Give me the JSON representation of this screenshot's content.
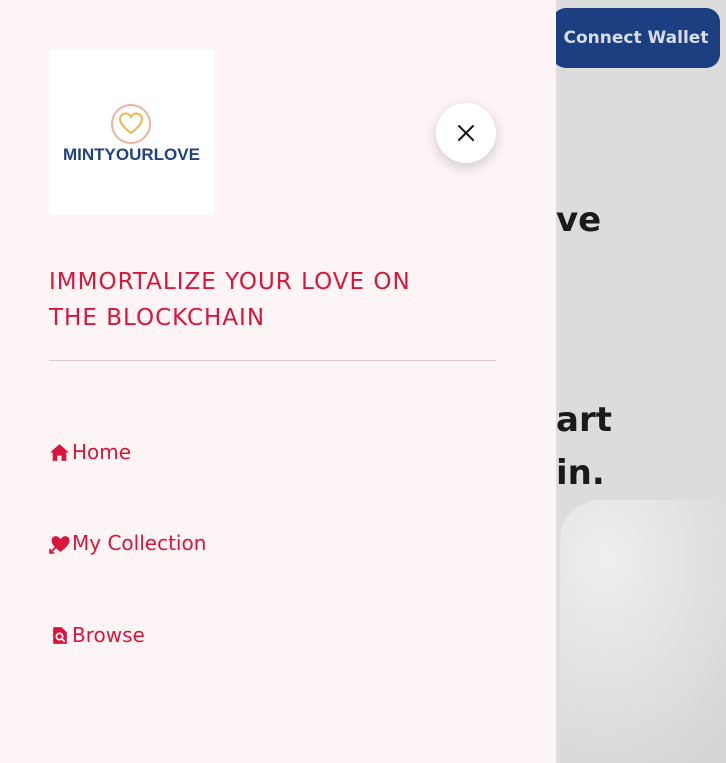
{
  "header": {
    "connect_wallet_label": "Connect Wallet"
  },
  "background": {
    "line1": "ve",
    "line2": "art",
    "line3": "in."
  },
  "drawer": {
    "logo_text": "MINTYOURLOVE",
    "tagline": "IMMORTALIZE YOUR LOVE ON THE BLOCKCHAIN",
    "nav": [
      {
        "label": "Home",
        "icon": "home-icon"
      },
      {
        "label": "My Collection",
        "icon": "heart-arrow-icon"
      },
      {
        "label": "Browse",
        "icon": "search-document-icon"
      }
    ],
    "close_icon": "close-icon"
  },
  "colors": {
    "accent": "#d8163c",
    "drawer_bg": "#fdf4f5",
    "wallet_button": "#1c3f82",
    "logo_text": "#23417e",
    "logo_heart": "#f0b84c"
  }
}
